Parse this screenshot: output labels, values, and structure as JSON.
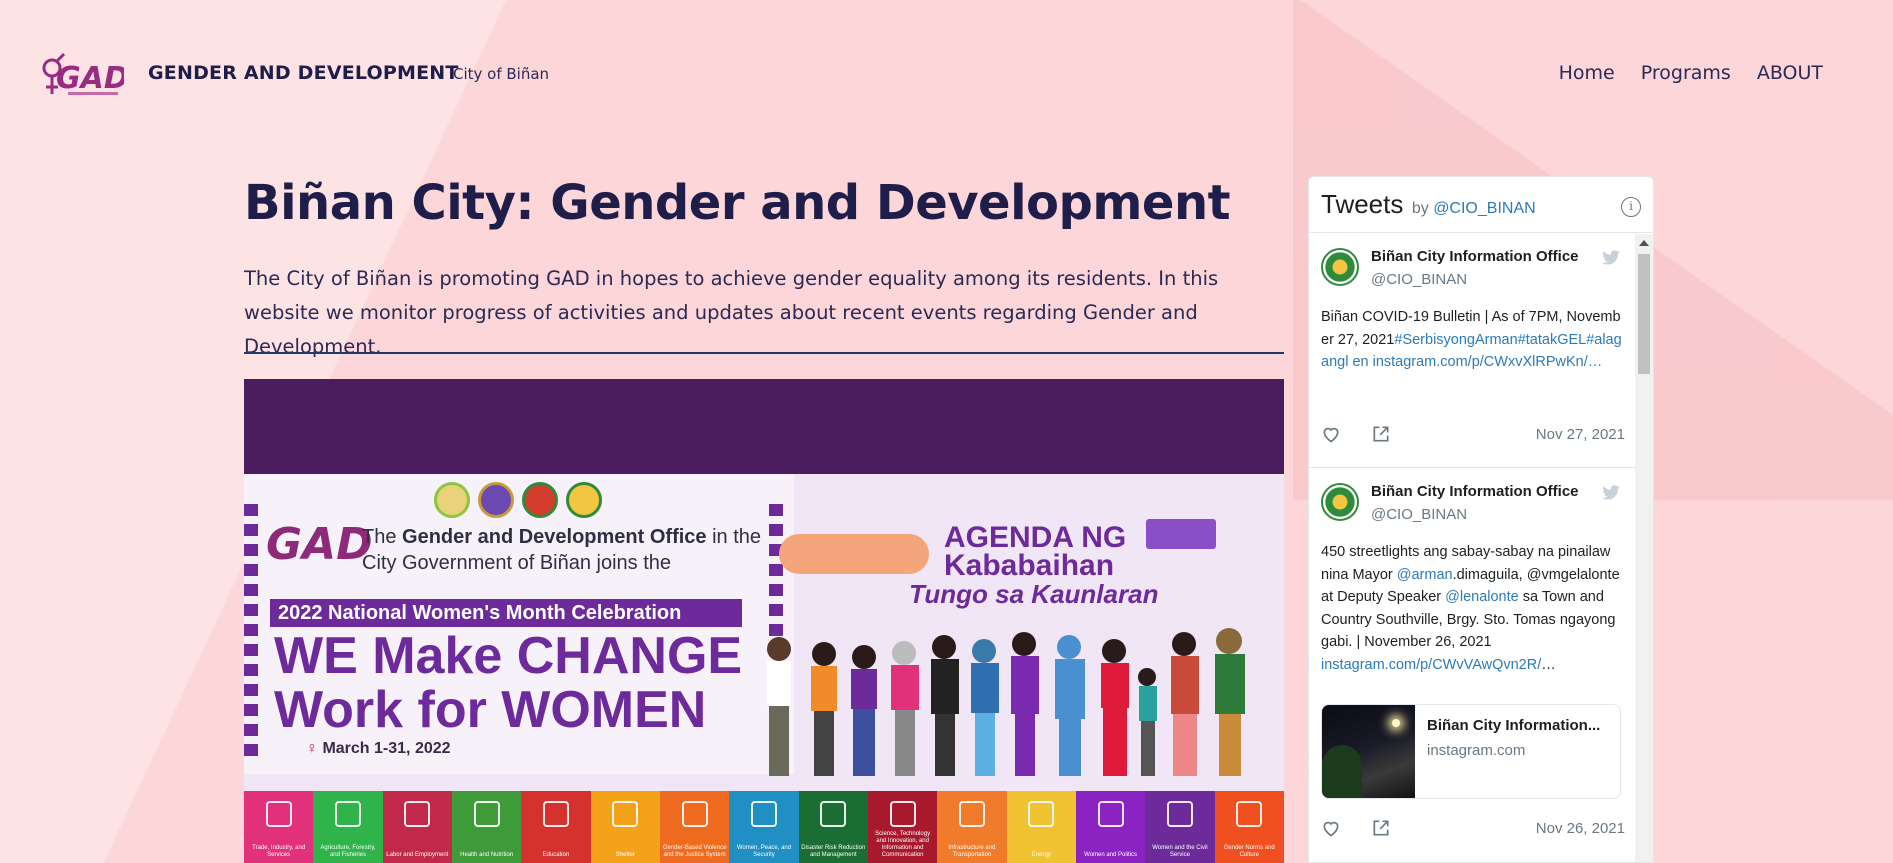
{
  "header": {
    "brand_title": "GENDER AND DEVELOPMENT",
    "brand_subtitle": "City of Biñan",
    "logo_text": "GAD",
    "nav": [
      "Home",
      "Programs",
      "ABOUT"
    ]
  },
  "main": {
    "title": "Biñan City: Gender and Development",
    "intro": "The City of Biñan is promoting GAD in hopes to achieve gender equality among its residents. In this website we monitor progress of activities and updates about recent events regarding Gender and Development."
  },
  "banner": {
    "gad": "GAD",
    "line1_pre": "The ",
    "line1_bold": "Gender and Development Office",
    "line1_post": " in the",
    "line2": "City Government of Biñan joins the",
    "tag": "2022 National Women's Month Celebration",
    "headline": "WE Make CHANGE Work for WOMEN",
    "date": "March 1-31, 2022",
    "agenda": "AGENDA NG Kababaihan",
    "agenda_sub": "Tungo sa Kaunlaran",
    "sectors": [
      {
        "label": "Trade, Industry, and Services",
        "color": "#e0317a"
      },
      {
        "label": "Agriculture, Forestry, and Fisheries",
        "color": "#2fb34a"
      },
      {
        "label": "Labor and Employment",
        "color": "#c2284a"
      },
      {
        "label": "Health and Nutrition",
        "color": "#3f9a3a"
      },
      {
        "label": "Education",
        "color": "#d5322f"
      },
      {
        "label": "Shelter",
        "color": "#f4a21a"
      },
      {
        "label": "Gender-Based Violence and the Justice System",
        "color": "#ef6b1f"
      },
      {
        "label": "Women, Peace, and Security",
        "color": "#1f8fc4"
      },
      {
        "label": "Disaster Risk Reduction and Management",
        "color": "#1a6d33"
      },
      {
        "label": "Science, Technology and Innovation, and Information and Communication",
        "color": "#a8192e"
      },
      {
        "label": "Infrastructure and Transportation",
        "color": "#f07b2a"
      },
      {
        "label": "Energy",
        "color": "#f1c232"
      },
      {
        "label": "Women and Politics",
        "color": "#8b22c2"
      },
      {
        "label": "Women and the Civil Service",
        "color": "#6d2a9b"
      },
      {
        "label": "Gender Norms and Culture",
        "color": "#f0501f"
      }
    ]
  },
  "twitter": {
    "title": "Tweets",
    "by": "by",
    "handle_link": "@CIO_BINAN",
    "tweets": [
      {
        "name": "Biñan City Information Office",
        "handle": "@CIO_BINAN",
        "text_plain": "Biñan COVID-19 Bulletin | As of 7PM, November 27, 2021",
        "text_link": "#SerbisyongArman#tatakGEL#alagangl en instagram.com/p/CWxvXlRPwKn/…",
        "date": "Nov 27, 2021"
      },
      {
        "name": "Biñan City Information Office",
        "handle": "@CIO_BINAN",
        "text_a": "450 streetlights ang sabay-sabay na pinailaw nina Mayor ",
        "link_a": "@arman",
        "text_b": ".dimaguila, @vmgelalonte at Deputy Speaker ",
        "link_b": "@lenalonte",
        "text_c": " sa Town and Country Southville, Brgy. Sto. Tomas ngayong gabi. | November 26, 2021 ",
        "link_c": "instagram.com/p/CWvVAwQvn2R/",
        "text_d": "…",
        "card_title": "Biñan City Information...",
        "card_domain": "instagram.com",
        "date": "Nov 26, 2021"
      }
    ]
  },
  "colors": {
    "background": "#fcd6d8",
    "navy": "#1f1d4a",
    "banner_purple": "#4a1d5e",
    "link": "#2b7bb9"
  }
}
